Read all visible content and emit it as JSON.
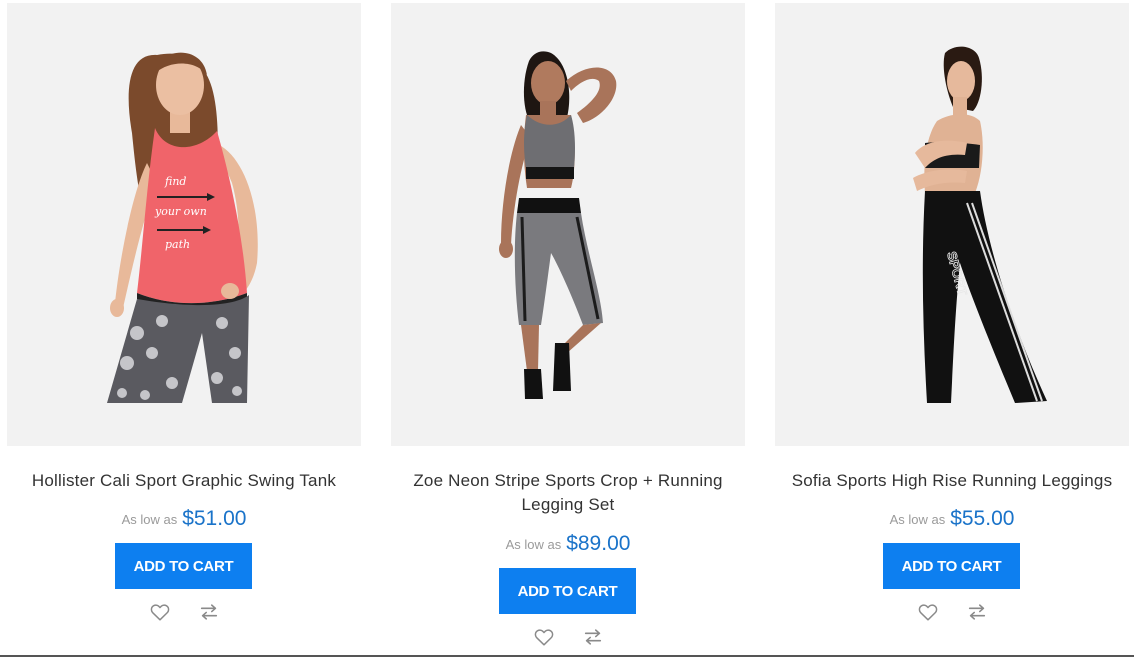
{
  "products": [
    {
      "name": "Hollister Cali Sport Graphic Swing Tank",
      "price_label": "As low as",
      "price": "$51.00",
      "cart_label": "ADD TO CART",
      "wishlist_icon": "heart-outline-icon",
      "compare_icon": "compare-arrows-icon",
      "image": "woman-in-coral-swing-tank-and-patterned-leggings"
    },
    {
      "name": "Zoe Neon Stripe Sports Crop + Running Legging Set",
      "price_label": "As low as",
      "price": "$89.00",
      "cart_label": "ADD TO CART",
      "wishlist_icon": "heart-outline-icon",
      "compare_icon": "compare-arrows-icon",
      "image": "woman-in-grey-crop-top-and-capri-leggings"
    },
    {
      "name": "Sofia Sports High Rise Running Leggings",
      "price_label": "As low as",
      "price": "$55.00",
      "cart_label": "ADD TO CART",
      "wishlist_icon": "heart-outline-icon",
      "compare_icon": "compare-arrows-icon",
      "image": "woman-in-black-sport-leggings",
      "legging_print": "SPORT"
    }
  ],
  "colors": {
    "accent": "#0d7ff0",
    "price": "#1a73c9",
    "image_bg": "#f2f2f2"
  }
}
